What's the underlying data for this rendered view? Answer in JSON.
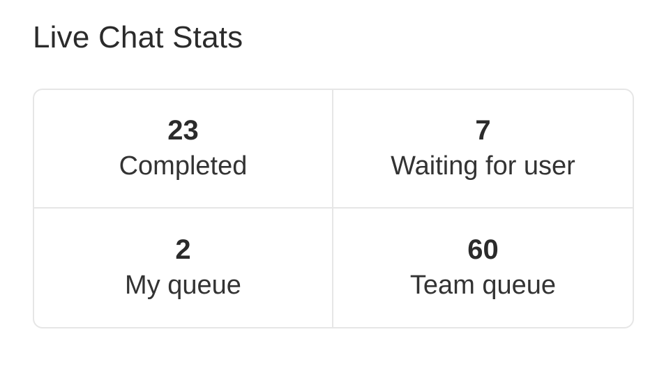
{
  "widget": {
    "title": "Live Chat Stats",
    "stats": [
      {
        "value": "23",
        "label": "Completed"
      },
      {
        "value": "7",
        "label": "Waiting for user"
      },
      {
        "value": "2",
        "label": "My queue"
      },
      {
        "value": "60",
        "label": "Team queue"
      }
    ]
  },
  "colors": {
    "text": "#2b2b2b",
    "border": "#e6e6e6",
    "background": "#ffffff"
  }
}
